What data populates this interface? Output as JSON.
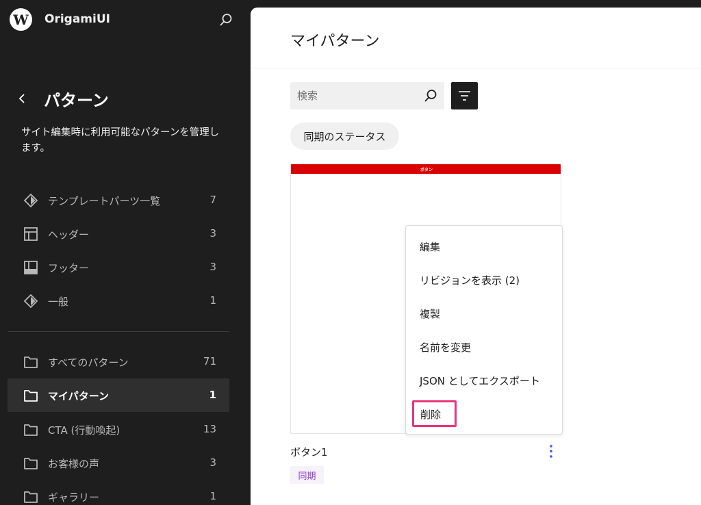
{
  "site": {
    "name": "OrigamiUI",
    "logo_icon": "wordpress-logo-icon"
  },
  "sidebar": {
    "title": "パターン",
    "description": "サイト編集時に利用可能なパターンを管理します。",
    "template_parts": [
      {
        "label": "テンプレートパーツ一覧",
        "count": "7",
        "icon": "diamond-icon"
      },
      {
        "label": "ヘッダー",
        "count": "3",
        "icon": "header-layout-icon"
      },
      {
        "label": "フッター",
        "count": "3",
        "icon": "footer-layout-icon"
      },
      {
        "label": "一般",
        "count": "1",
        "icon": "diamond-icon"
      }
    ],
    "categories": [
      {
        "label": "すべてのパターン",
        "count": "71",
        "icon": "folder-icon"
      },
      {
        "label": "マイパターン",
        "count": "1",
        "icon": "folder-icon",
        "active": true
      },
      {
        "label": "CTA (行動喚起)",
        "count": "13",
        "icon": "folder-icon"
      },
      {
        "label": "お客様の声",
        "count": "3",
        "icon": "folder-icon"
      },
      {
        "label": "ギャラリー",
        "count": "1",
        "icon": "folder-icon"
      }
    ]
  },
  "main": {
    "title": "マイパターン",
    "search": {
      "placeholder": "検索",
      "value": ""
    },
    "sync_filter": "同期のステータス",
    "patterns": [
      {
        "preview_text": "ボタン",
        "name": "ボタン1",
        "badge": "同期"
      }
    ]
  },
  "menu": {
    "items": [
      "編集",
      "リビジョンを表示 (2)",
      "複製",
      "名前を変更",
      "JSON としてエクスポート",
      "削除"
    ],
    "highlighted": "削除"
  },
  "colors": {
    "sidebar_bg": "#1e1e1e",
    "accent_purple": "#8a3fc7",
    "highlight_pink": "#e8357c",
    "preview_red": "#d80000"
  }
}
